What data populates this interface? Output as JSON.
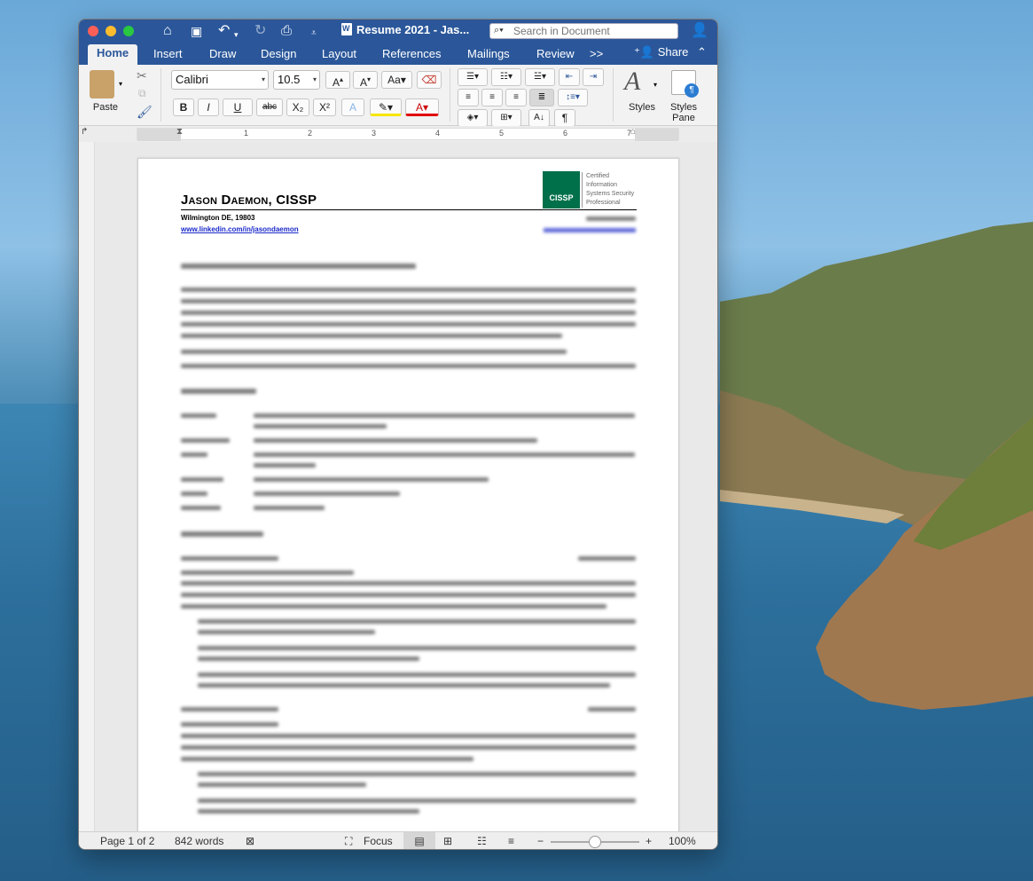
{
  "app": {
    "title": "Resume 2021 - Jas...",
    "search_placeholder": "Search in Document"
  },
  "tabs": [
    {
      "label": "Home"
    },
    {
      "label": "Insert"
    },
    {
      "label": "Draw"
    },
    {
      "label": "Design"
    },
    {
      "label": "Layout"
    },
    {
      "label": "References"
    },
    {
      "label": "Mailings"
    },
    {
      "label": "Review"
    }
  ],
  "tabs_overflow": ">>",
  "share_label": "Share",
  "ribbon": {
    "paste_label": "Paste",
    "font_name": "Calibri",
    "font_size": "10.5",
    "bold": "B",
    "italic": "I",
    "underline": "U",
    "strikethrough": "abc",
    "subscript": "X₂",
    "superscript": "X²",
    "change_case": "Aa",
    "styles_label": "Styles",
    "styles_pane_label": "Styles Pane",
    "styles_pane_label_line1": "Styles",
    "styles_pane_label_line2": "Pane"
  },
  "ruler": {
    "ticks": [
      "1",
      "2",
      "3",
      "4",
      "5",
      "6",
      "7"
    ]
  },
  "document": {
    "name": "Jason Daemon, CISSP",
    "location": "Wilmington DE, 19803",
    "linkedin": "www.linkedin.com/in/jasondaemon",
    "cissp_badge": "CISSP",
    "cissp_text": [
      "Certified",
      "Information",
      "Systems Security",
      "Professional"
    ]
  },
  "status": {
    "page": "Page 1 of 2",
    "words": "842 words",
    "focus": "Focus",
    "zoom": "100%",
    "zoom_level_percent": 100
  },
  "colors": {
    "accent": "#2b579a",
    "cissp_green": "#00704a",
    "link": "#1a29c9"
  }
}
